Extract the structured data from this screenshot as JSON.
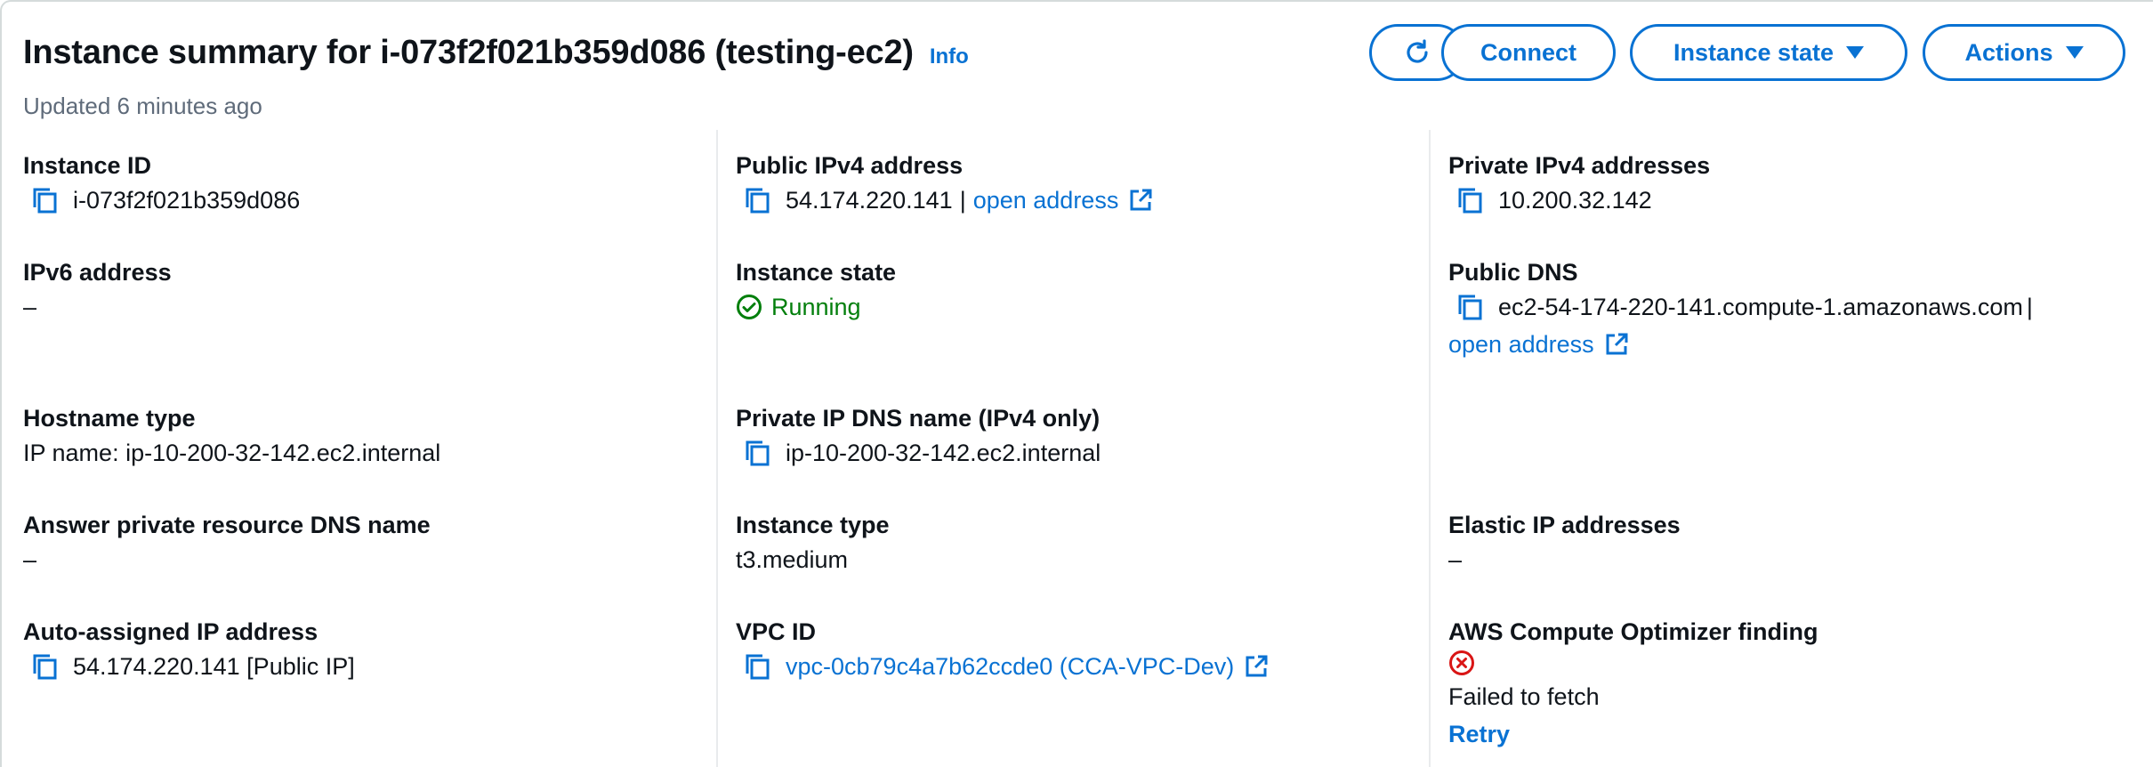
{
  "header": {
    "title": "Instance summary for i-073f2f021b359d086 (testing-ec2)",
    "info_label": "Info",
    "updated": "Updated 6 minutes ago",
    "buttons": {
      "connect": "Connect",
      "instance_state": "Instance state",
      "actions": "Actions"
    }
  },
  "colors": {
    "link": "#0972d3",
    "success": "#037f0c",
    "error": "#d91515",
    "muted": "#5f6b7a"
  },
  "icons": [
    "refresh-icon",
    "copy-icon",
    "external-link-icon",
    "caret-down-icon",
    "check-circle-icon",
    "error-circle-icon"
  ],
  "col1": {
    "instance_id": {
      "label": "Instance ID",
      "value": "i-073f2f021b359d086"
    },
    "ipv6": {
      "label": "IPv6 address",
      "value": "–"
    },
    "hostname_type": {
      "label": "Hostname type",
      "value": "IP name: ip-10-200-32-142.ec2.internal"
    },
    "answer_dns": {
      "label": "Answer private resource DNS name",
      "value": "–"
    },
    "auto_ip": {
      "label": "Auto-assigned IP address",
      "value": "54.174.220.141 [Public IP]"
    }
  },
  "col2": {
    "public_ipv4": {
      "label": "Public IPv4 address",
      "value": "54.174.220.141",
      "separator": "|",
      "link": "open address"
    },
    "state": {
      "label": "Instance state",
      "value": "Running"
    },
    "private_dns": {
      "label": "Private IP DNS name (IPv4 only)",
      "value": "ip-10-200-32-142.ec2.internal"
    },
    "type": {
      "label": "Instance type",
      "value": "t3.medium"
    },
    "vpc": {
      "label": "VPC ID",
      "value": "vpc-0cb79c4a7b62ccde0 (CCA-VPC-Dev)"
    }
  },
  "col3": {
    "private_ipv4": {
      "label": "Private IPv4 addresses",
      "value": "10.200.32.142"
    },
    "public_dns": {
      "label": "Public DNS",
      "value": "ec2-54-174-220-141.compute-1.amazonaws.com",
      "separator": "|",
      "link": "open address"
    },
    "elastic_ip": {
      "label": "Elastic IP addresses",
      "value": "–"
    },
    "optimizer": {
      "label": "AWS Compute Optimizer finding",
      "status": "Failed to fetch",
      "retry": "Retry"
    }
  }
}
